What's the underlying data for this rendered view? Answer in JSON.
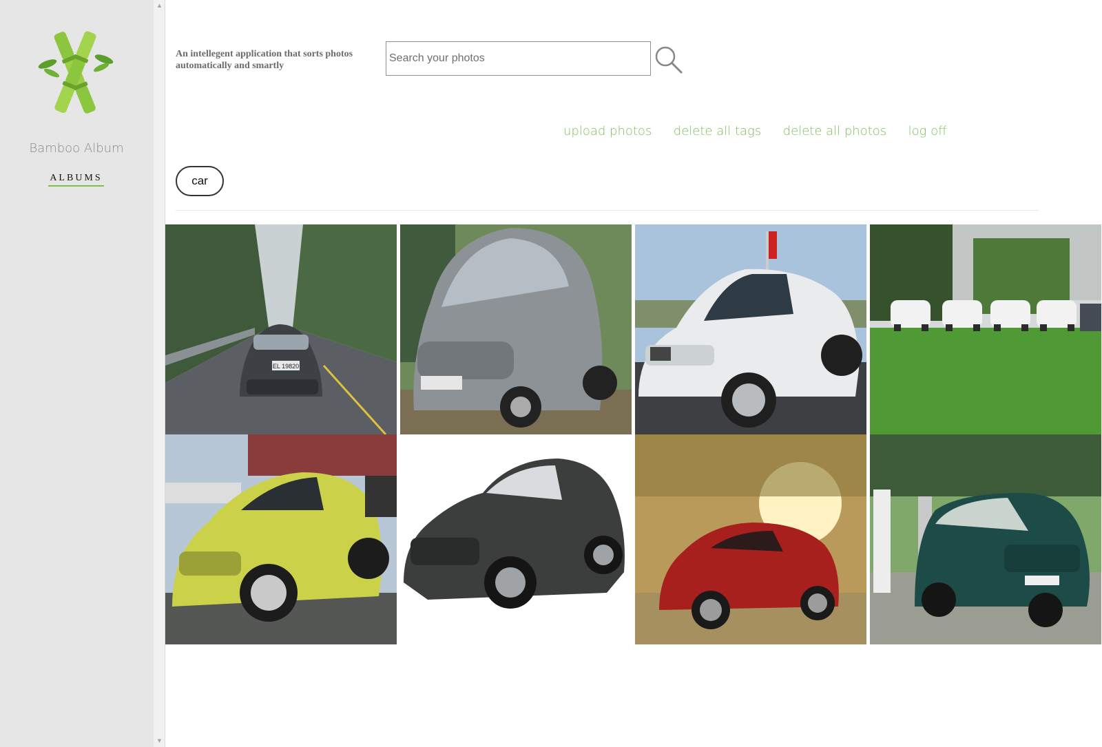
{
  "sidebar": {
    "app_name": "Bamboo Album",
    "albums_label": "ALBUMS",
    "logo_icon": "bamboo-logo-icon"
  },
  "header": {
    "tagline": "An intellegent application that sorts photos automatically and smartly",
    "search": {
      "placeholder": "Search your photos",
      "value": "",
      "icon": "search-icon"
    }
  },
  "nav": {
    "upload": "upload photos",
    "delete_tags": "delete all tags",
    "delete_photos": "delete all photos",
    "logoff": "log off"
  },
  "tag": {
    "label": "car"
  },
  "colors": {
    "accent": "#7cbf5a",
    "sidebar_bg": "#e6e6e6"
  },
  "photos": [
    {
      "plate": "EL 19820"
    },
    {
      "plate": ""
    },
    {
      "plate": ""
    },
    {
      "plate": ""
    },
    {
      "plate": ""
    },
    {
      "plate": ""
    },
    {
      "plate": ""
    },
    {
      "plate": ""
    }
  ]
}
